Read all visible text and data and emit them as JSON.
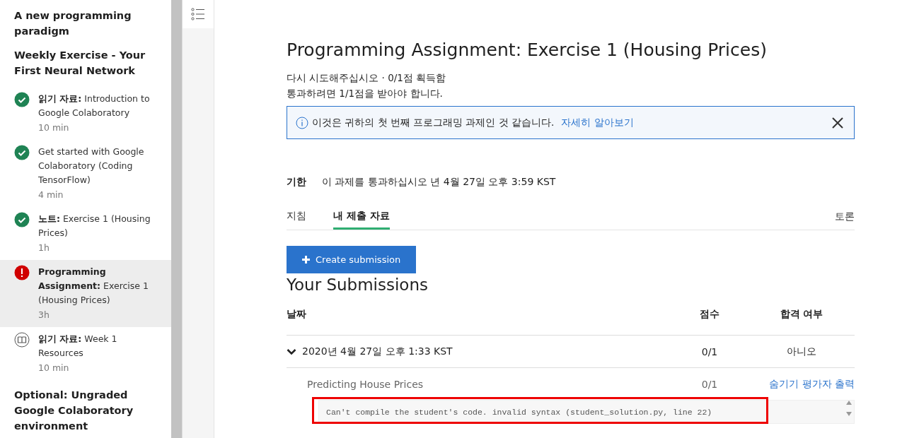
{
  "sidebar": {
    "sections": [
      {
        "title": "A new programming paradigm"
      },
      {
        "title": "Weekly Exercise - Your First Neural Network",
        "items": [
          {
            "label": "**읽기 자료:** Introduction to Google Colaboratory",
            "duration": "10 min",
            "kind": "complete",
            "selected": false
          },
          {
            "label": "Get started with Google Colaboratory (Coding TensorFlow)",
            "duration": "4 min",
            "kind": "complete",
            "selected": false
          },
          {
            "label": "**노트:** Exercise 1 (Housing Prices)",
            "duration": "1h",
            "kind": "complete",
            "selected": false
          },
          {
            "label": "**Programming Assignment:** Exercise 1 (Housing Prices)",
            "duration": "3h",
            "kind": "failed",
            "selected": true
          },
          {
            "label": "**읽기 자료:** Week 1 Resources",
            "duration": "10 min",
            "kind": "reading",
            "selected": false
          }
        ]
      },
      {
        "title": "Optional: Ungraded Google Colaboratory environment"
      }
    ]
  },
  "main": {
    "title": "Programming Assignment: Exercise 1 (Housing Prices)",
    "status_lines": [
      "다시 시도해주십시오 · 0/1점 획득함",
      "통과하려면 1/1점을 받아야 합니다."
    ],
    "notice": {
      "text": "이것은 귀하의 첫 번째 프로그래밍 과제인 것 같습니다.",
      "link": "자세히 알아보기"
    },
    "deadline": {
      "label": "기한",
      "value": "이 과제를 통과하십시오 년 4월 27일 오후 3:59 KST"
    },
    "tabs": [
      {
        "label": "지침",
        "selected": false
      },
      {
        "label": "내 제출 자료",
        "selected": true
      }
    ],
    "discussion_link": "토론",
    "create_button": "Create submission",
    "submissions_title": "Your Submissions",
    "table": {
      "columns": [
        "날짜",
        "점수",
        "합격 여부"
      ],
      "rows": [
        {
          "date": "2020년 4월 27일 오후 1:33 KST",
          "score": "0/1",
          "passed": "아니오",
          "expanded": true,
          "parts": [
            {
              "name": "Predicting House Prices",
              "score": "0/1",
              "action": "숨기기 평가자 출력",
              "output": "Can't compile the student's code. invalid syntax (student_solution.py, line 22)"
            }
          ]
        }
      ]
    }
  }
}
